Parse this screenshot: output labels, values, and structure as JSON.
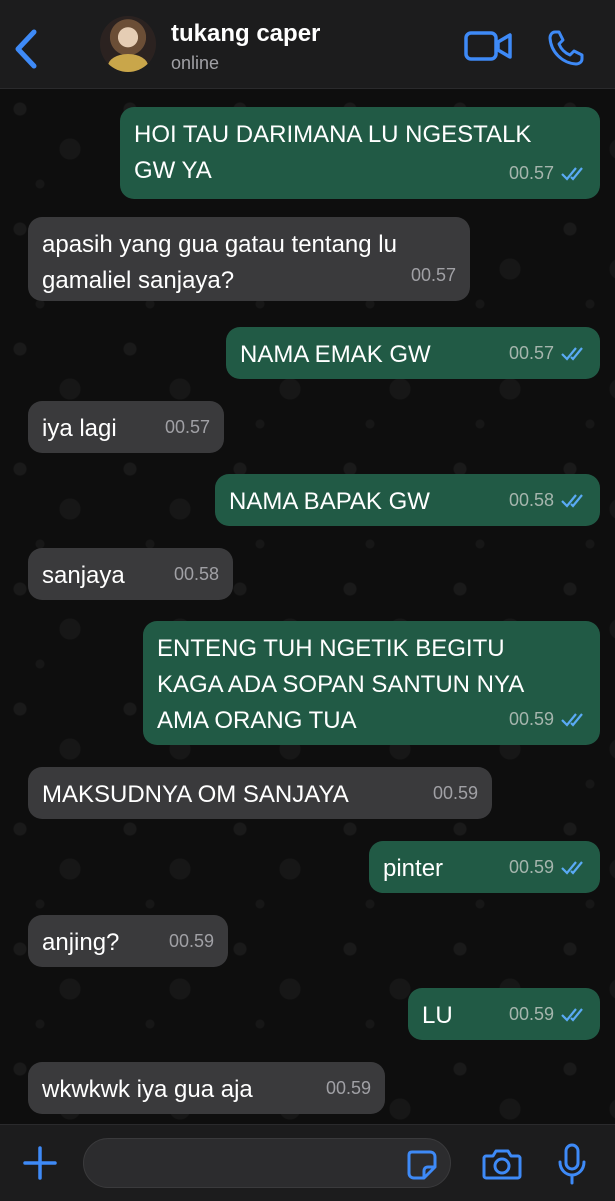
{
  "header": {
    "contact_name": "tukang caper",
    "status": "online",
    "back_icon": "chevron-left-icon",
    "video_icon": "video-camera-icon",
    "phone_icon": "phone-icon"
  },
  "messages": [
    {
      "dir": "out",
      "text": "HOI TAU DARIMANA LU NGESTALK\nGW YA",
      "time": "00.57"
    },
    {
      "dir": "in",
      "text": "apasih yang gua gatau tentang lu\ngamaliel sanjaya?",
      "time": "00.57"
    },
    {
      "dir": "out",
      "text": "NAMA EMAK GW",
      "time": "00.57"
    },
    {
      "dir": "in",
      "text": "iya lagi",
      "time": "00.57"
    },
    {
      "dir": "out",
      "text": "NAMA BAPAK GW",
      "time": "00.58"
    },
    {
      "dir": "in",
      "text": "sanjaya",
      "time": "00.58"
    },
    {
      "dir": "out",
      "text": "ENTENG TUH NGETIK BEGITU\nKAGA ADA SOPAN SANTUN NYA\nAMA ORANG TUA",
      "time": "00.59"
    },
    {
      "dir": "in",
      "text": "MAKSUDNYA OM SANJAYA",
      "time": "00.59"
    },
    {
      "dir": "out",
      "text": "pinter",
      "time": "00.59"
    },
    {
      "dir": "in",
      "text": "anjing?",
      "time": "00.59"
    },
    {
      "dir": "out",
      "text": "LU",
      "time": "00.59"
    },
    {
      "dir": "in",
      "text": "wkwkwk iya gua aja",
      "time": "00.59"
    }
  ],
  "composer": {
    "placeholder": "",
    "plus_icon": "plus-icon",
    "sticker_icon": "sticker-icon",
    "camera_icon": "camera-icon",
    "mic_icon": "microphone-icon"
  },
  "colors": {
    "accent": "#3e8af7",
    "outgoing_bubble": "#215a45",
    "incoming_bubble": "#3a3a3c",
    "read_ticks": "#5aaaf5"
  }
}
